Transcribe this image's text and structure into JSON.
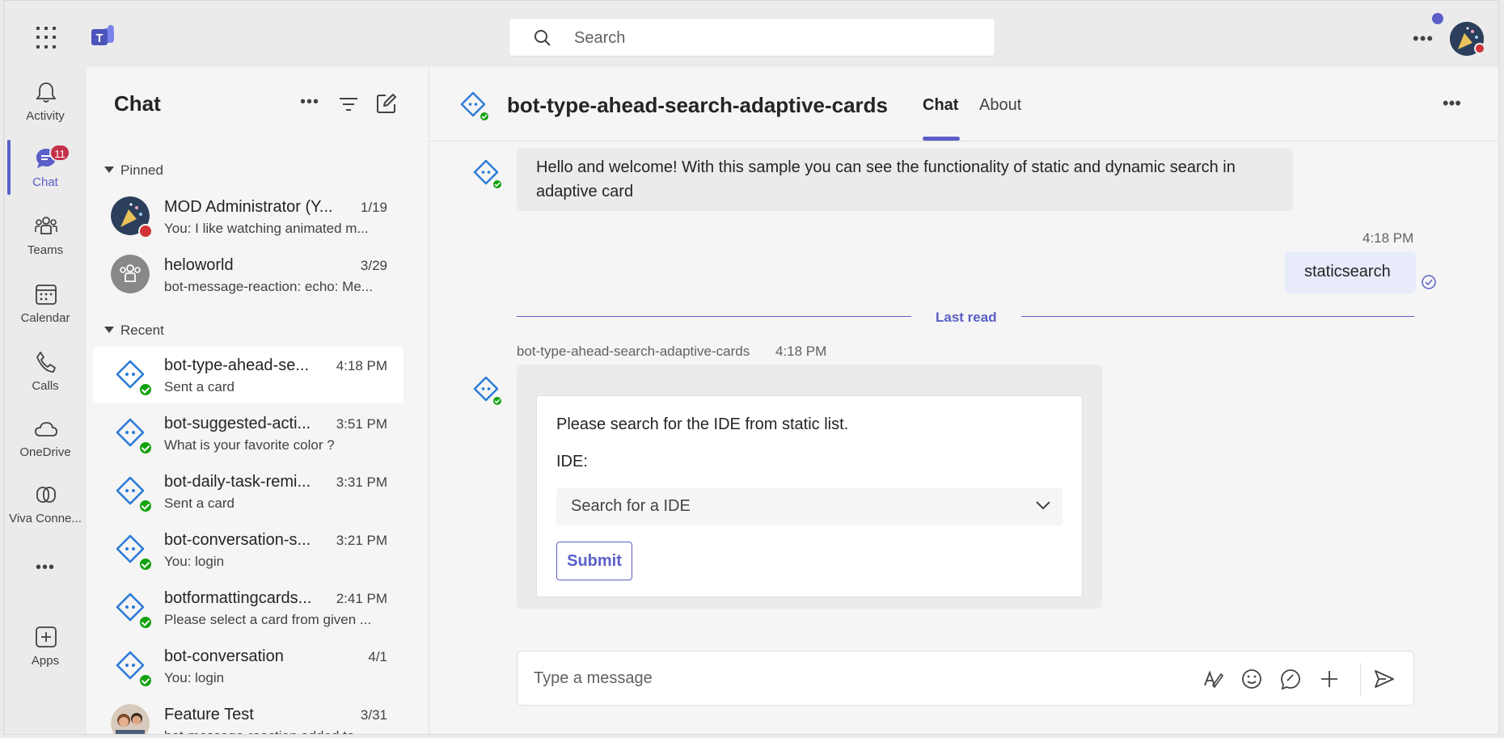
{
  "topbar": {
    "search_placeholder": "Search"
  },
  "rail": {
    "items": [
      {
        "label": "Activity"
      },
      {
        "label": "Chat",
        "badge": "11"
      },
      {
        "label": "Teams"
      },
      {
        "label": "Calendar"
      },
      {
        "label": "Calls"
      },
      {
        "label": "OneDrive"
      },
      {
        "label": "Viva Conne..."
      },
      {
        "label": "Apps"
      }
    ]
  },
  "chatlist": {
    "title": "Chat",
    "pinned_label": "Pinned",
    "recent_label": "Recent",
    "pinned": [
      {
        "name": "MOD Administrator (Y...",
        "time": "1/19",
        "preview": "You: I like watching animated m..."
      },
      {
        "name": "heloworld",
        "time": "3/29",
        "preview": "bot-message-reaction: echo: Me..."
      }
    ],
    "recent": [
      {
        "name": "bot-type-ahead-se...",
        "time": "4:18 PM",
        "preview": "Sent a card"
      },
      {
        "name": "bot-suggested-acti...",
        "time": "3:51 PM",
        "preview": "What is your favorite color ?"
      },
      {
        "name": "bot-daily-task-remi...",
        "time": "3:31 PM",
        "preview": "Sent a card"
      },
      {
        "name": "bot-conversation-s...",
        "time": "3:21 PM",
        "preview": "You: login"
      },
      {
        "name": "botformattingcards...",
        "time": "2:41 PM",
        "preview": "Please select a card from given ..."
      },
      {
        "name": "bot-conversation",
        "time": "4/1",
        "preview": "You: login"
      },
      {
        "name": "Feature Test",
        "time": "3/31",
        "preview": "bot-message-reaction added to..."
      }
    ]
  },
  "header": {
    "title": "bot-type-ahead-search-adaptive-cards",
    "tabs": [
      "Chat",
      "About"
    ]
  },
  "messages": {
    "welcome": "Hello and welcome! With this sample you can see the functionality of static and dynamic search in adaptive card",
    "sent_time": "4:18 PM",
    "sent_text": "staticsearch",
    "last_read": "Last read",
    "bot_sender": "bot-type-ahead-search-adaptive-cards",
    "bot_time": "4:18 PM",
    "card": {
      "prompt": "Please search for the IDE from static list.",
      "field_label": "IDE:",
      "dropdown_placeholder": "Search for a IDE",
      "submit_label": "Submit"
    }
  },
  "composer": {
    "placeholder": "Type a message"
  },
  "colors": {
    "accent": "#5b5fc7",
    "presence_available": "#13a10e",
    "presence_busy": "#d13438",
    "badge": "#c4314b"
  }
}
